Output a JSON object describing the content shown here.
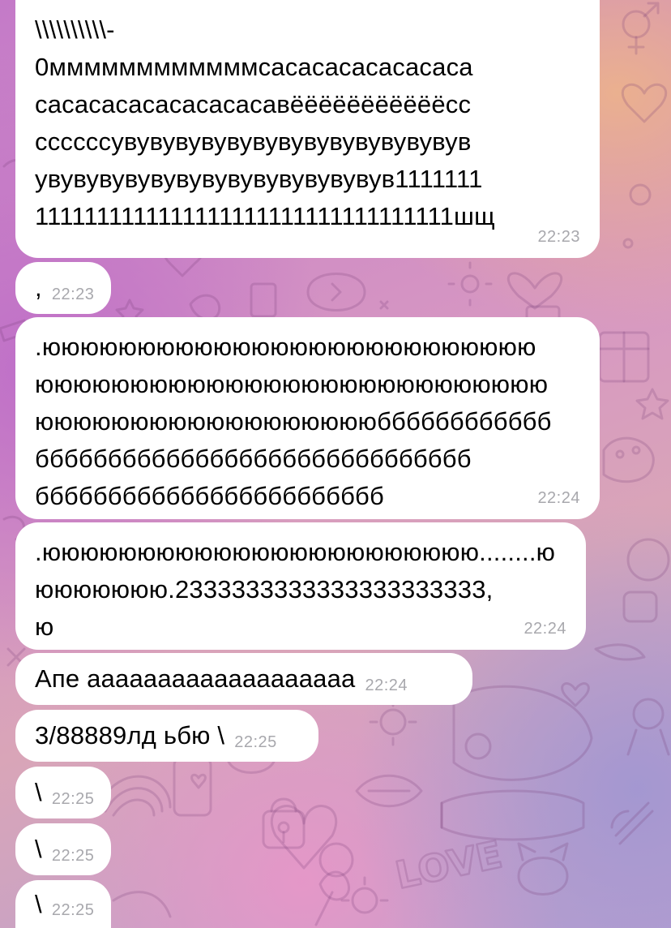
{
  "chat": {
    "messages": [
      {
        "lines": [
          "\\\\\\\\\\\\\\\\\\\\-",
          "0ммммммммммммсасасасасасасаса",
          "сасасасасасасасасавёёёёёёёёёёёсс",
          "ссссссувувувувувувувувувувувувувув",
          "увувувувувувувувувувувувувув1111111",
          "1111111111111111111111111111111111шщ"
        ],
        "time": "22:23"
      },
      {
        "lines": [
          ","
        ],
        "time": "22:23"
      },
      {
        "lines": [
          ".юююююююююююююююююююююююююю",
          "ююююююююююююююююююююююююююю",
          "ююююююююююююююююююбббббббббббб",
          "бббббббббббббббббббббббббббббб",
          "бббббббббббббббббббббббб"
        ],
        "time": "22:24"
      },
      {
        "lines": [
          ".ююююююююююююююююююююююю........ю",
          "ююююююю.2333333333333333333333,",
          "ю"
        ],
        "time": "22:24"
      },
      {
        "lines": [
          "Апе ааааааааааааааааааа"
        ],
        "time": "22:24"
      },
      {
        "lines": [
          "3/88889лд ьбю \\"
        ],
        "time": "22:25"
      },
      {
        "lines": [
          "\\"
        ],
        "time": "22:25"
      },
      {
        "lines": [
          "\\"
        ],
        "time": "22:25"
      },
      {
        "lines": [
          "\\"
        ],
        "time": "22:25"
      }
    ]
  },
  "wallpaper": {
    "pattern_text": "LOVE",
    "colors": {
      "top_right": "#ecb28c",
      "left": "#be6ec8",
      "bottom": "#e896c8",
      "bottom_right": "#a096d2"
    }
  }
}
